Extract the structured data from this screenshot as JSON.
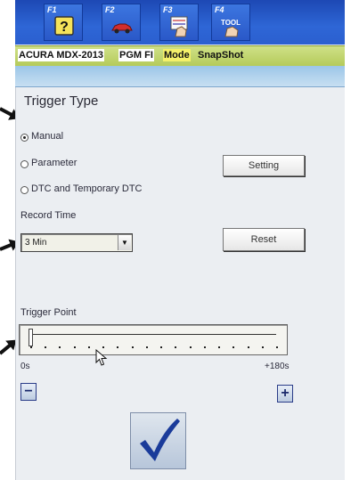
{
  "colors": {
    "fkey_bar": "#2e66d6",
    "title_bar": "#c4d672",
    "band": "#b3d4ee",
    "screen_bg": "#ebeef2",
    "check_mark": "#1a3b9a"
  },
  "fkeys": [
    {
      "label": "F1",
      "icon": "help-question-icon"
    },
    {
      "label": "F2",
      "icon": "car-icon"
    },
    {
      "label": "F3",
      "icon": "data-list-hand-icon"
    },
    {
      "label": "F4",
      "icon": "tool-hand-icon"
    }
  ],
  "title_bar": {
    "vehicle": "ACURA MDX-2013",
    "system": "PGM FI",
    "mode": "Mode",
    "function": "SnapShot"
  },
  "trigger": {
    "heading": "Trigger Type",
    "options": [
      {
        "label": "Manual",
        "selected": true
      },
      {
        "label": "Parameter",
        "selected": false
      },
      {
        "label": "DTC and Temporary DTC",
        "selected": false
      }
    ],
    "setting_button": "Setting"
  },
  "record": {
    "label": "Record Time",
    "selected_value": "3 Min",
    "caret_icon": "dropdown-arrow-icon",
    "reset_button": "Reset"
  },
  "trigger_point": {
    "label": "Trigger Point",
    "min_label": "0s",
    "max_label": "+180s",
    "value_fraction": 0.0,
    "decrease_icon": "minus-icon",
    "increase_icon": "plus-icon"
  },
  "confirm": {
    "icon": "checkmark-icon"
  }
}
